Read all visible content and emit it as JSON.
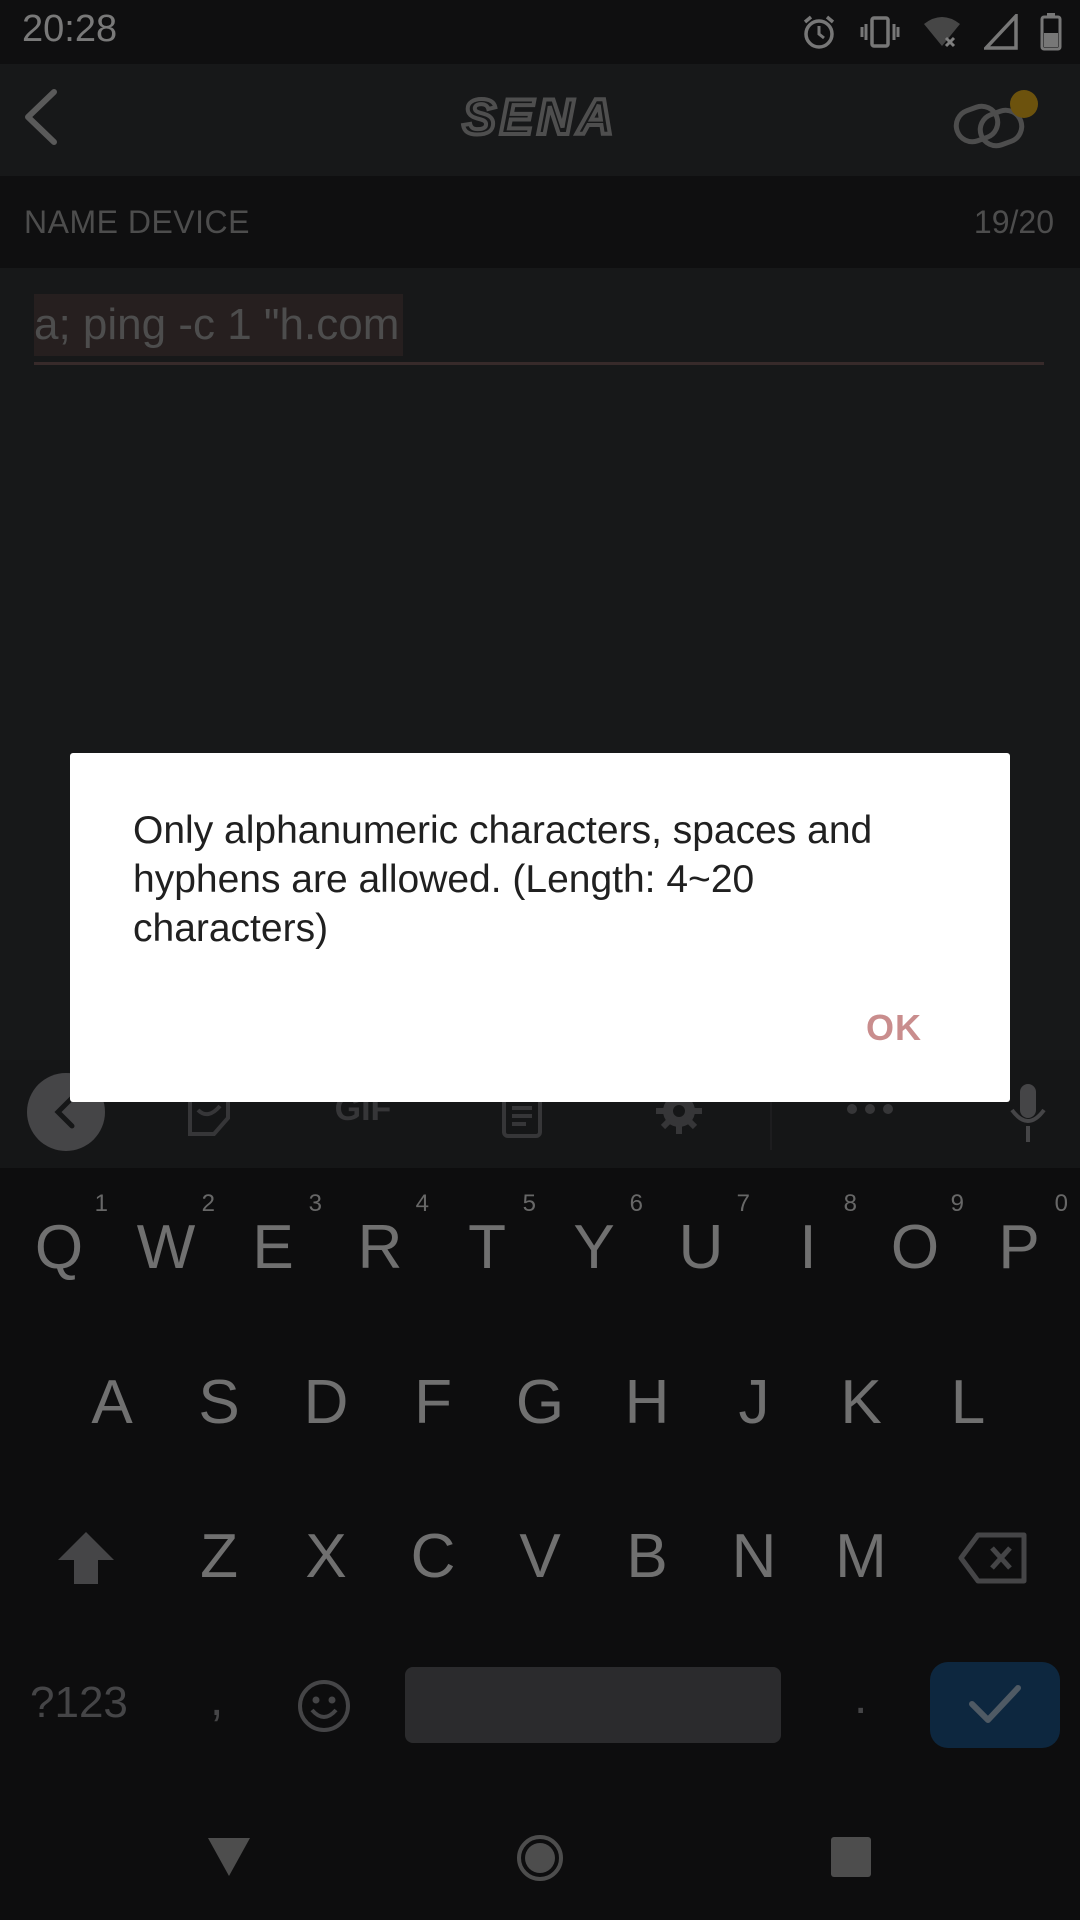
{
  "status_bar": {
    "time": "20:28",
    "icons": [
      "alarm-icon",
      "vibrate-icon",
      "wifi-icon",
      "signal-icon",
      "battery-icon"
    ]
  },
  "app_bar": {
    "logo_text": "SENA",
    "back_icon": "chevron-left-icon",
    "link_icon": "link-icon",
    "badge_color": "#d8a51a"
  },
  "name_device": {
    "label": "NAME DEVICE",
    "count": "19/20",
    "input_value": "a; ping -c 1 \"h.com"
  },
  "keyboard": {
    "toolbar_icons": [
      "collapse-icon",
      "sticker-icon",
      "gif-icon",
      "clipboard-icon",
      "settings-icon",
      "more-icon",
      "mic-icon"
    ],
    "row1": [
      {
        "key": "Q",
        "hint": "1"
      },
      {
        "key": "W",
        "hint": "2"
      },
      {
        "key": "E",
        "hint": "3"
      },
      {
        "key": "R",
        "hint": "4"
      },
      {
        "key": "T",
        "hint": "5"
      },
      {
        "key": "Y",
        "hint": "6"
      },
      {
        "key": "U",
        "hint": "7"
      },
      {
        "key": "I",
        "hint": "8"
      },
      {
        "key": "O",
        "hint": "9"
      },
      {
        "key": "P",
        "hint": "0"
      }
    ],
    "row2": [
      "A",
      "S",
      "D",
      "F",
      "G",
      "H",
      "J",
      "K",
      "L"
    ],
    "row3": [
      "Z",
      "X",
      "C",
      "V",
      "B",
      "N",
      "M"
    ],
    "symbols_label": "?123",
    "comma": ",",
    "period": "."
  },
  "dialog": {
    "message": "Only alphanumeric characters, spaces and hyphens are allowed. (Length: 4~20 characters)",
    "ok_label": "OK"
  },
  "colors": {
    "accent_ok": "#c98d8d",
    "enter_key": "#1b4f7e"
  }
}
